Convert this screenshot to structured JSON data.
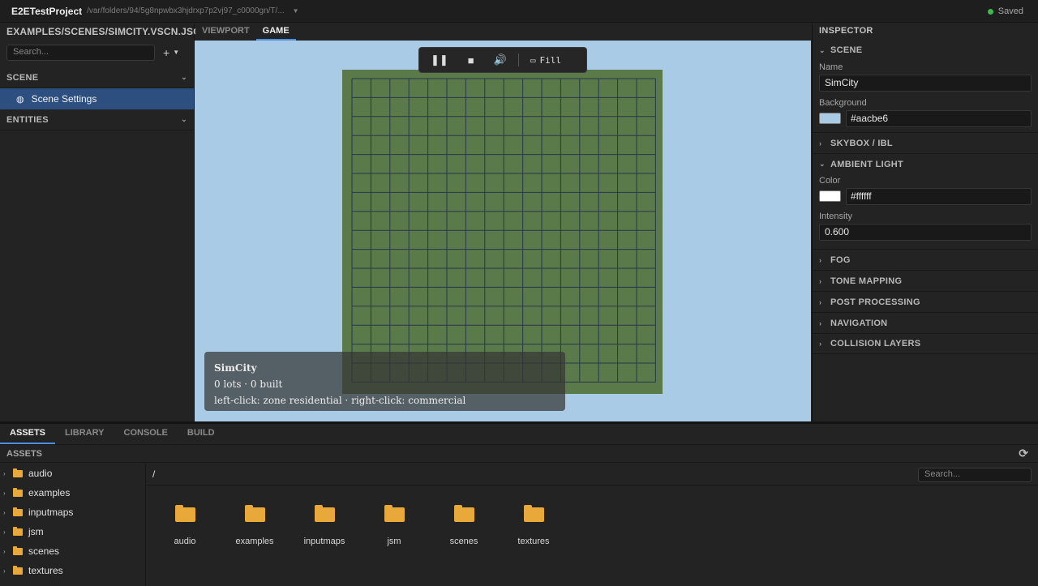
{
  "titlebar": {
    "project": "E2ETestProject",
    "path": "/var/folders/94/5g8npwbx3hjdrxp7p2vj97_c0000gn/T/...",
    "status": "Saved"
  },
  "left": {
    "file": "EXAMPLES/SCENES/SIMCITY.VSCN.JSON",
    "search_placeholder": "Search...",
    "scene_header": "SCENE",
    "scene_item": "Scene Settings",
    "entities_header": "ENTITIES"
  },
  "center": {
    "tabs": [
      "VIEWPORT",
      "GAME"
    ],
    "active_tab": "GAME",
    "toolbar": {
      "fill_label": "Fill"
    },
    "background": "#aacbe6",
    "board": {
      "color": "#5a7a4a",
      "line_color": "#27374a",
      "cols": 16,
      "rows": 16
    },
    "hud": {
      "title": "SimCity",
      "line1": "0 lots · 0 built",
      "line2": "left-click: zone residential · right-click: commercial"
    }
  },
  "inspector": {
    "title": "INSPECTOR",
    "scene_section": "SCENE",
    "name_label": "Name",
    "name_value": "SimCity",
    "background_label": "Background",
    "background_value": "#aacbe6",
    "skybox": "SKYBOX / IBL",
    "ambient": "AMBIENT LIGHT",
    "color_label": "Color",
    "color_value": "#ffffff",
    "intensity_label": "Intensity",
    "intensity_value": "0.600",
    "sections": [
      "FOG",
      "TONE MAPPING",
      "POST PROCESSING",
      "NAVIGATION",
      "COLLISION LAYERS"
    ]
  },
  "bottom": {
    "tabs": [
      "ASSETS",
      "LIBRARY",
      "CONSOLE",
      "BUILD"
    ],
    "active_tab": "ASSETS",
    "assets_header": "ASSETS",
    "breadcrumb": "/",
    "search_placeholder": "Search...",
    "tree": [
      "audio",
      "examples",
      "inputmaps",
      "jsm",
      "scenes",
      "textures"
    ],
    "folders": [
      "audio",
      "examples",
      "inputmaps",
      "jsm",
      "scenes",
      "textures"
    ],
    "folder_color": "#e8a93a"
  }
}
